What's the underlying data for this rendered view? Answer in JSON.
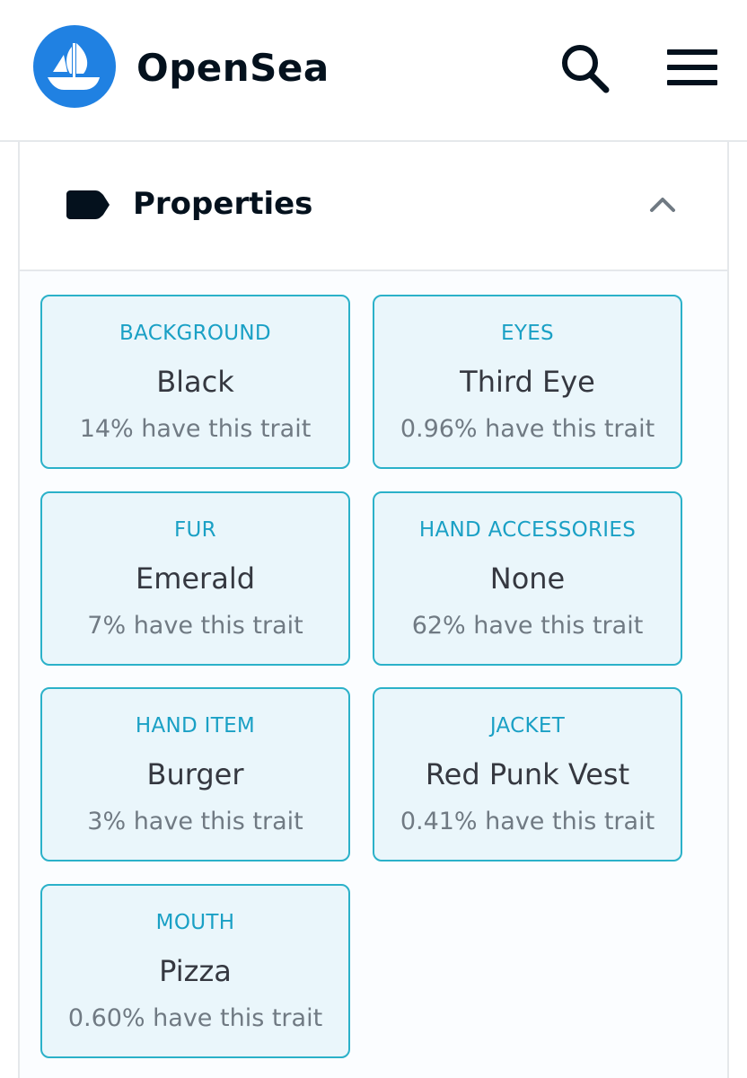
{
  "header": {
    "brand": "OpenSea",
    "icons": {
      "logo": "opensea-ship-logo",
      "search": "search-icon",
      "menu": "hamburger-menu-icon"
    }
  },
  "colors": {
    "brand_blue": "#2081e2",
    "card_border": "#2bb1c9",
    "card_bg": "#eaf6fb",
    "trait_type": "#1aa0c5",
    "value_text": "#353840",
    "rarity_text": "#707a83"
  },
  "properties": {
    "title": "Properties",
    "icons": {
      "title": "tag-icon",
      "toggle": "chevron-up-icon"
    },
    "expanded": true,
    "traits": [
      {
        "type": "BACKGROUND",
        "value": "Black",
        "rarity": "14% have this trait"
      },
      {
        "type": "EYES",
        "value": "Third Eye",
        "rarity": "0.96% have this trait"
      },
      {
        "type": "FUR",
        "value": "Emerald",
        "rarity": "7% have this trait"
      },
      {
        "type": "HAND ACCESSORIES",
        "value": "None",
        "rarity": "62% have this trait"
      },
      {
        "type": "HAND ITEM",
        "value": "Burger",
        "rarity": "3% have this trait"
      },
      {
        "type": "JACKET",
        "value": "Red Punk Vest",
        "rarity": "0.41% have this trait"
      },
      {
        "type": "MOUTH",
        "value": "Pizza",
        "rarity": "0.60% have this trait"
      }
    ]
  }
}
